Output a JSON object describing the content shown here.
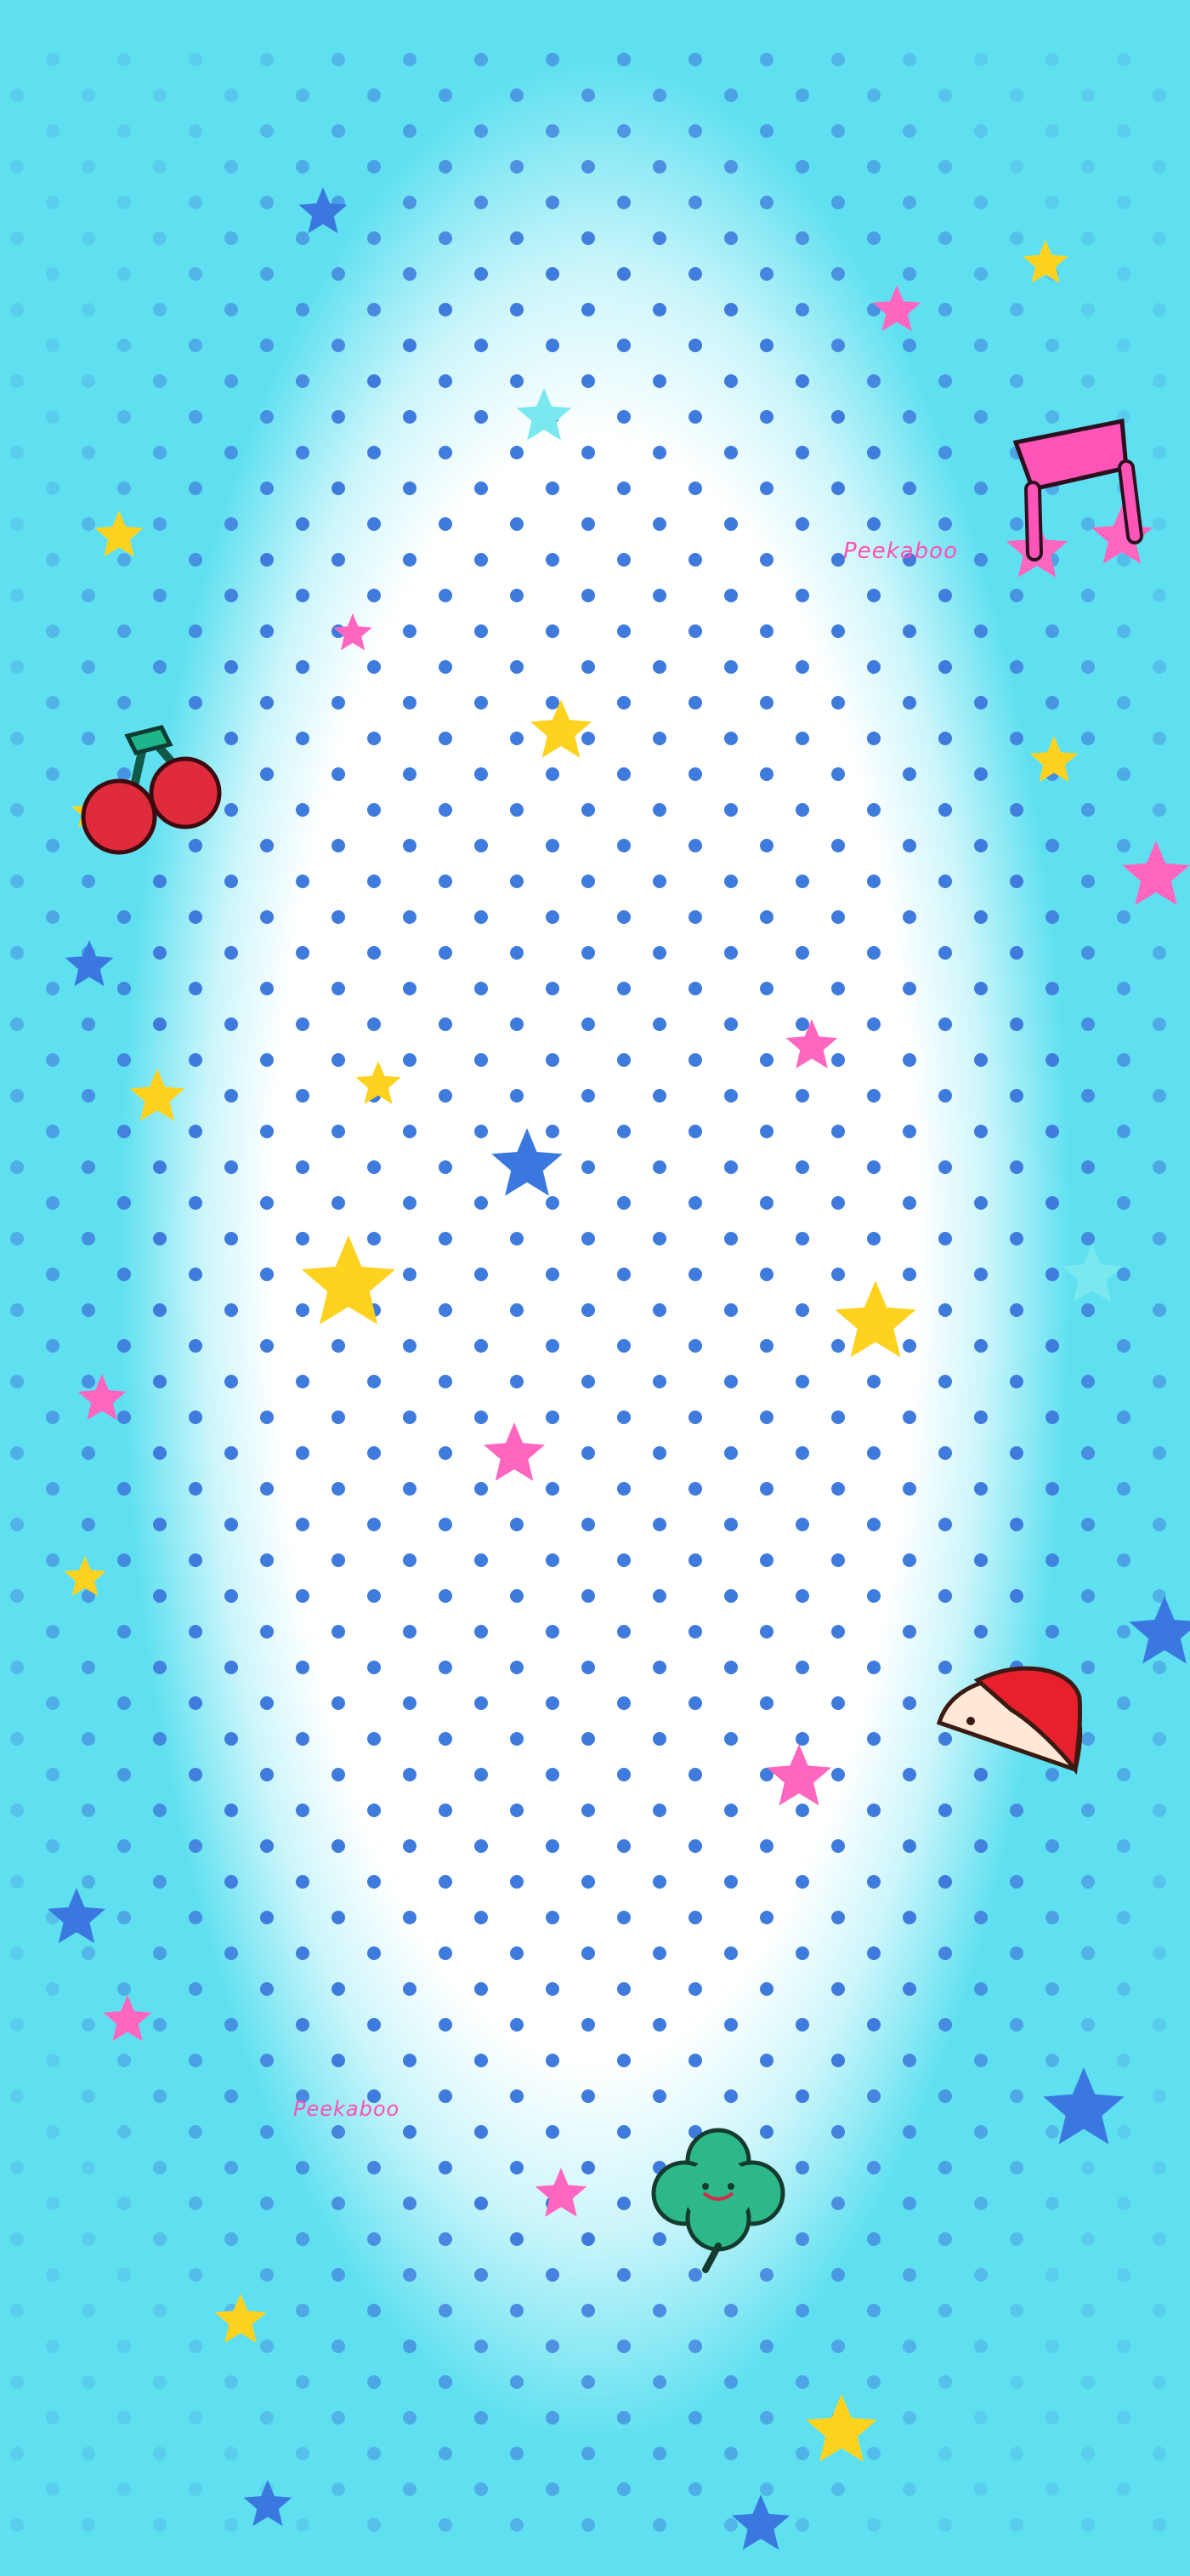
{
  "wallpaper": {
    "watermark_text": "Peekaboo",
    "colors": {
      "background": "#5fe0f0",
      "center": "#ffffff",
      "dot": "#3f7bdc",
      "star_yellow": "#ffd21f",
      "star_pink": "#ff66bf",
      "star_blue": "#3a78e0",
      "star_cyan": "#7ae9ef"
    },
    "icons": [
      "cherry-icon",
      "music-note-icon",
      "apple-slice-icon",
      "clover-icon",
      "star-icon"
    ]
  }
}
